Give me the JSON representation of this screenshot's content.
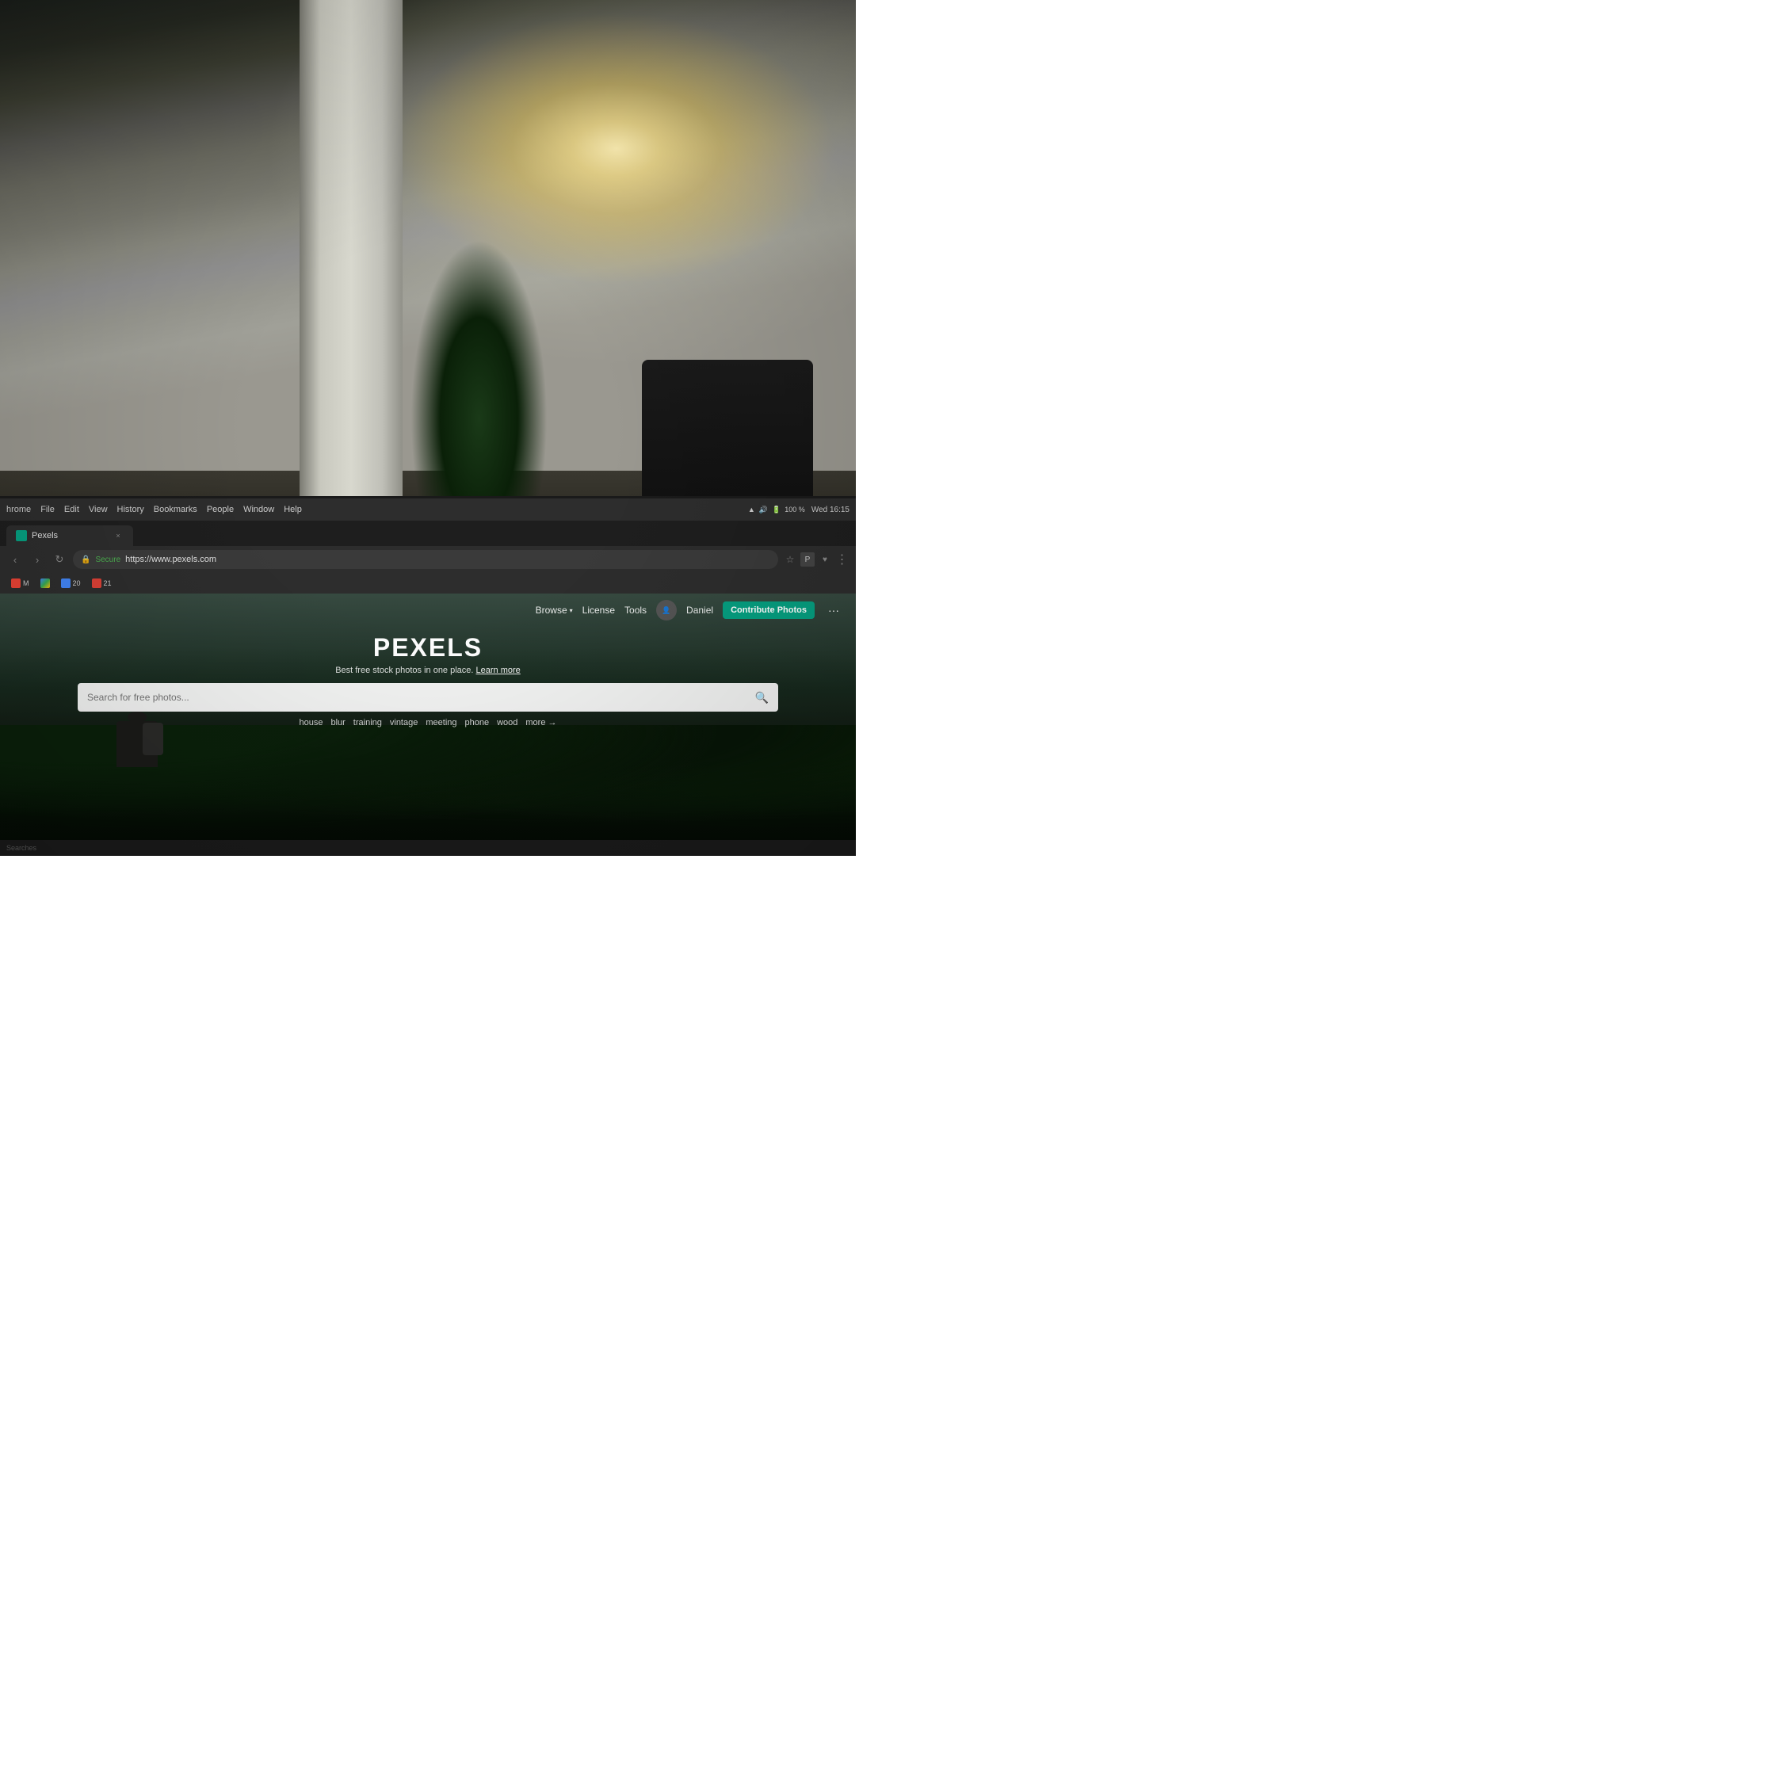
{
  "background": {
    "office_description": "Blurred office space with bokeh light and plants"
  },
  "chrome": {
    "os_menu": {
      "items": [
        "hrome",
        "File",
        "Edit",
        "View",
        "History",
        "Bookmarks",
        "People",
        "Window",
        "Help"
      ]
    },
    "status": {
      "time": "Wed 16:15",
      "battery": "100 %"
    },
    "tab": {
      "title": "Pexels",
      "close_label": "×"
    },
    "address_bar": {
      "secure_label": "Secure",
      "url": "https://www.pexels.com"
    }
  },
  "pexels": {
    "nav": {
      "browse_label": "Browse",
      "license_label": "License",
      "tools_label": "Tools",
      "user_name": "Daniel",
      "contribute_label": "Contribute Photos",
      "more_label": "···"
    },
    "hero": {
      "logo": "PEXELS",
      "subtitle": "Best free stock photos in one place.",
      "learn_more": "Learn more",
      "search_placeholder": "Search for free photos...",
      "suggestions": [
        "house",
        "blur",
        "training",
        "vintage",
        "meeting",
        "phone",
        "wood"
      ],
      "more_label": "more →"
    }
  },
  "bottom_bar": {
    "status": "Searches"
  }
}
